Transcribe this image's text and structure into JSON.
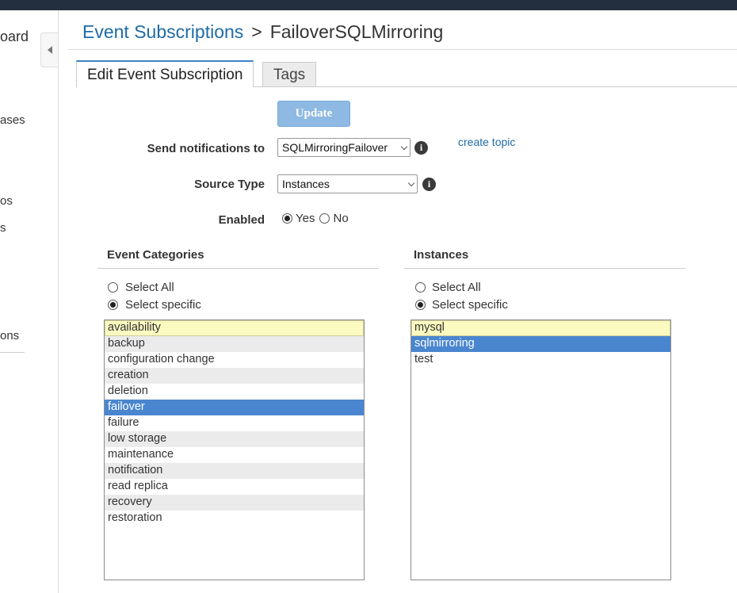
{
  "sidebar": {
    "items": [
      "oard",
      "ases",
      "os",
      "s",
      "ons"
    ]
  },
  "breadcrumb": {
    "parent": "Event Subscriptions",
    "separator": ">",
    "current": "FailoverSQLMirroring"
  },
  "tabs": [
    {
      "label": "Edit Event Subscription",
      "active": true
    },
    {
      "label": "Tags",
      "active": false
    }
  ],
  "form": {
    "update_button": "Update",
    "send_notifications_label": "Send notifications to",
    "send_notifications_value": "SQLMirroringFailover",
    "create_topic_link": "create topic",
    "source_type_label": "Source Type",
    "source_type_value": "Instances",
    "enabled_label": "Enabled",
    "enabled_options": [
      "Yes",
      "No"
    ],
    "enabled_value": "Yes"
  },
  "event_categories": {
    "title": "Event Categories",
    "select_all_label": "Select All",
    "select_specific_label": "Select specific",
    "mode": "specific",
    "items": [
      "availability",
      "backup",
      "configuration change",
      "creation",
      "deletion",
      "failover",
      "failure",
      "low storage",
      "maintenance",
      "notification",
      "read replica",
      "recovery",
      "restoration"
    ],
    "selected": [
      "failover"
    ],
    "focused": "availability"
  },
  "instances": {
    "title": "Instances",
    "select_all_label": "Select All",
    "select_specific_label": "Select specific",
    "mode": "specific",
    "items": [
      "mysql",
      "sqlmirroring",
      "test"
    ],
    "selected": [
      "sqlmirroring"
    ],
    "focused": "mysql"
  },
  "colors": {
    "topbar": "#232f3e",
    "link": "#1f6ba6",
    "button_disabled": "#8db9e2",
    "selection": "#4a86cf",
    "focus": "#fbfac0",
    "alt_row": "#ebebeb"
  }
}
